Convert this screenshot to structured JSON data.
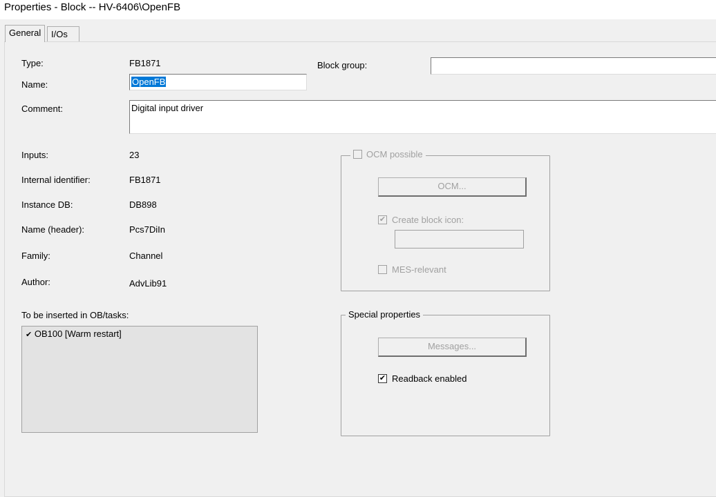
{
  "window": {
    "title": "Properties - Block -- HV-6406\\OpenFB"
  },
  "tabs": [
    {
      "label": "General",
      "active": true
    },
    {
      "label": "I/Os",
      "active": false
    }
  ],
  "general": {
    "type_label": "Type:",
    "type_value": "FB1871",
    "name_label": "Name:",
    "name_value": "OpenFB",
    "block_group_label": "Block group:",
    "block_group_value": "",
    "comment_label": "Comment:",
    "comment_value": "Digital input driver",
    "inputs_label": "Inputs:",
    "inputs_value": "23",
    "internal_id_label": "Internal identifier:",
    "internal_id_value": "FB1871",
    "instance_db_label": "Instance DB:",
    "instance_db_value": "DB898",
    "name_header_label": "Name (header):",
    "name_header_value": "Pcs7DiIn",
    "family_label": "Family:",
    "family_value": "Channel",
    "author_label": "Author:",
    "author_value": "AdvLib91",
    "ob_tasks_label": "To be inserted in OB/tasks:",
    "ob_tasks": [
      {
        "label": "OB100 [Warm restart]",
        "checked": true
      }
    ]
  },
  "ocm": {
    "ocm_possible_label": "OCM possible",
    "ocm_possible_checked": false,
    "ocm_button": "OCM...",
    "create_icon_label": "Create block icon:",
    "create_icon_checked": true,
    "create_icon_value": "",
    "mes_label": "MES-relevant",
    "mes_checked": false
  },
  "special": {
    "title": "Special properties",
    "messages_button": "Messages...",
    "readback_label": "Readback enabled",
    "readback_checked": true
  }
}
